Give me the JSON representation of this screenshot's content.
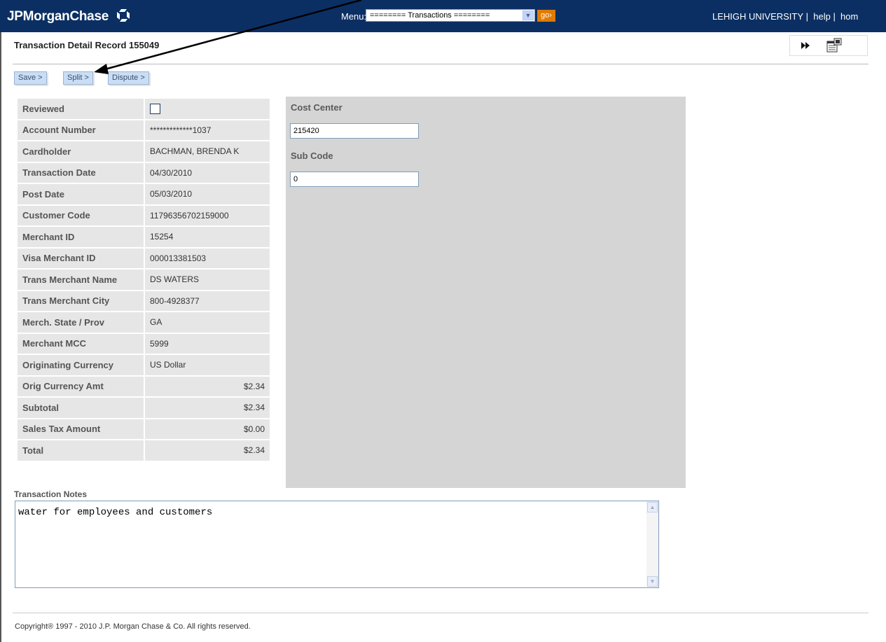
{
  "header": {
    "logo_text": "JPMorganChase",
    "menu_label": "Menu:",
    "menu_selected": "======== Transactions ========",
    "go_label": "go›",
    "links": [
      "LEHIGH UNIVERSITY",
      "help",
      "hom"
    ]
  },
  "page": {
    "title": "Transaction Detail Record 155049"
  },
  "toolbar": {
    "save_label": "Save >",
    "split_label": "Split >",
    "dispute_label": "Dispute >"
  },
  "detail": {
    "reviewed_label": "Reviewed",
    "rows": [
      {
        "label": "Account Number",
        "value": "*************1037"
      },
      {
        "label": "Cardholder",
        "value": "BACHMAN, BRENDA K"
      },
      {
        "label": "Transaction Date",
        "value": "04/30/2010"
      },
      {
        "label": "Post Date",
        "value": "05/03/2010"
      },
      {
        "label": "Customer Code",
        "value": "11796356702159000"
      },
      {
        "label": "Merchant ID",
        "value": "15254"
      },
      {
        "label": "Visa Merchant ID",
        "value": "000013381503"
      },
      {
        "label": "Trans Merchant Name",
        "value": "DS WATERS"
      },
      {
        "label": "Trans Merchant City",
        "value": "800-4928377"
      },
      {
        "label": "Merch. State / Prov",
        "value": "GA"
      },
      {
        "label": "Merchant MCC",
        "value": "5999"
      },
      {
        "label": "Originating Currency",
        "value": "US Dollar"
      },
      {
        "label": "Orig Currency Amt",
        "value": "$2.34"
      },
      {
        "label": "Subtotal",
        "value": "$2.34"
      },
      {
        "label": "Sales Tax Amount",
        "value": "$0.00"
      },
      {
        "label": "Total",
        "value": "$2.34"
      }
    ]
  },
  "panel": {
    "cost_center_label": "Cost Center",
    "cost_center_value": "215420",
    "sub_code_label": "Sub Code",
    "sub_code_value": "0"
  },
  "notes": {
    "label": "Transaction Notes",
    "text": "water for employees and customers"
  },
  "footer": {
    "copyright": "Copyright® 1997 - 2010 J.P. Morgan Chase & Co. All rights reserved."
  },
  "colors": {
    "header_bg": "#0b2f63",
    "go_button": "#e07b00",
    "button_bg": "#c9def5",
    "panel_bg": "#d5d5d5"
  }
}
